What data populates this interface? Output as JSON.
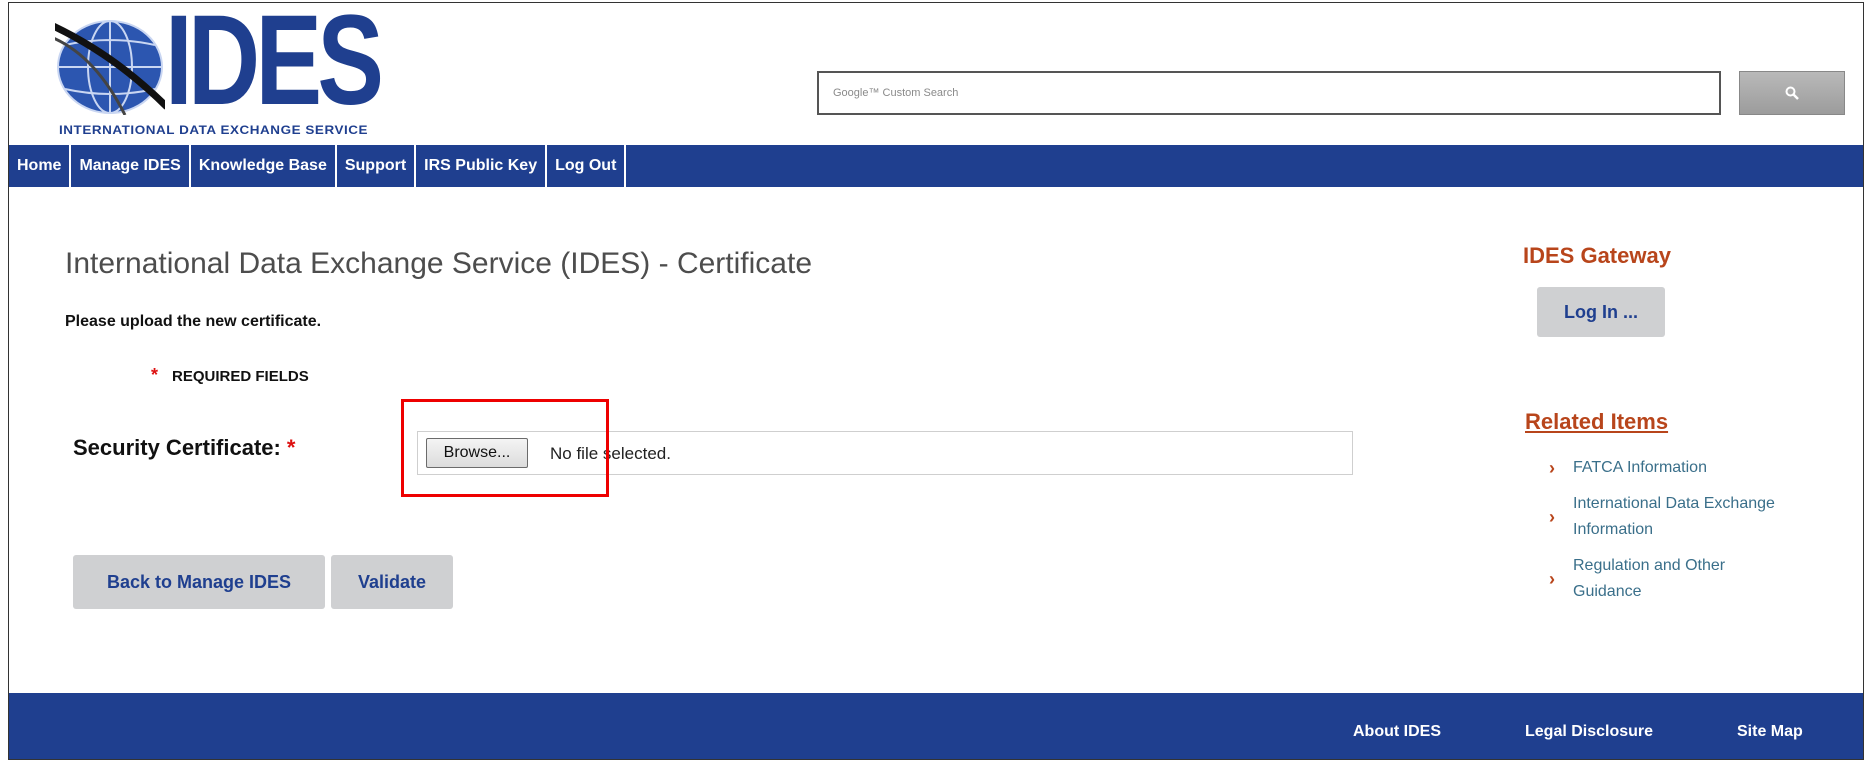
{
  "logo": {
    "word": "IDES",
    "subtitle": "INTERNATIONAL DATA EXCHANGE SERVICE"
  },
  "search": {
    "placeholder": "Google™ Custom Search"
  },
  "nav": [
    "Home",
    "Manage IDES",
    "Knowledge Base",
    "Support",
    "IRS Public Key",
    "Log Out"
  ],
  "main": {
    "title": "International Data Exchange Service (IDES) - Certificate",
    "instruction": "Please upload the new certificate.",
    "required": "REQUIRED FIELDS",
    "field_label": "Security Certificate:",
    "browse_label": "Browse...",
    "file_status": "No file selected.",
    "back_button": "Back to Manage IDES",
    "validate_button": "Validate"
  },
  "sidebar": {
    "gateway_title": "IDES Gateway",
    "login_button": "Log In ...",
    "related_title": "Related Items",
    "related": [
      "FATCA Information",
      "International Data Exchange Information",
      "Regulation and Other Guidance"
    ]
  },
  "footer": [
    "About IDES",
    "Legal Disclosure",
    "Site Map"
  ],
  "colors": {
    "navy": "#1f3f8f",
    "accent": "#b8451b",
    "link": "#3a6f8a",
    "required": "#dd1111"
  }
}
